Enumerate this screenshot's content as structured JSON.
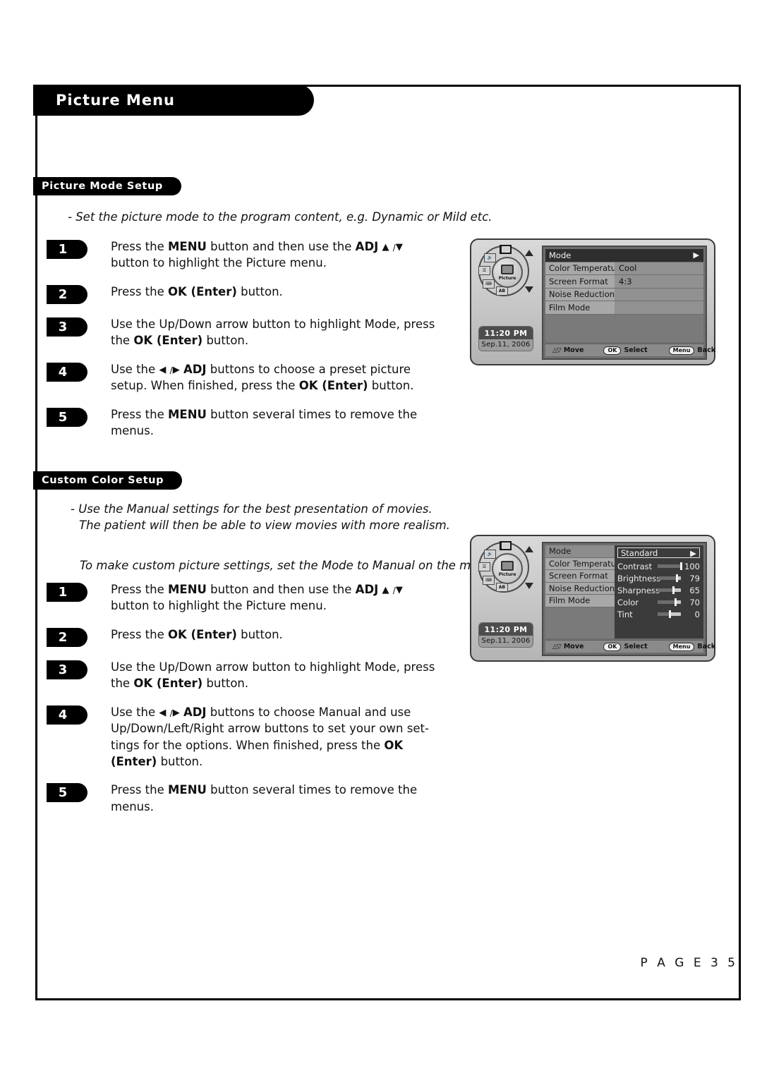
{
  "header": {
    "title": "Picture Menu"
  },
  "sections": [
    {
      "badge": "Picture Mode Setup",
      "intro": "- Set the picture mode to the program content, e.g. Dynamic or Mild etc.",
      "steps": [
        {
          "num": "1",
          "html": "Press the <b>MENU</b> button and then use the <b>ADJ</b> <span class=\"arrowglyph\">▲</span> <span class=\"sep\">/</span><span class=\"arrowglyph\">▼</span> button to highlight the Picture menu."
        },
        {
          "num": "2",
          "html": "Press the <b>OK (Enter)</b> button."
        },
        {
          "num": "3",
          "html": "Use the Up/Down arrow button to highlight Mode, press the <b>OK (Enter)</b> button."
        },
        {
          "num": "4",
          "html": "Use the <span class=\"arrowglyph\">◀</span> <span class=\"sep\">/</span><span class=\"arrowglyph\">▶</span> <b>ADJ</b> buttons to choose a preset picture setup. When finished, press the <b>OK (Enter)</b> button."
        },
        {
          "num": "5",
          "html": "Press the <b>MENU</b> button several times to remove the menus."
        }
      ]
    },
    {
      "badge": "Custom Color Setup",
      "intro_line_1": "- Use the Manual settings for the best presentation of movies.",
      "intro_line_2": "The patient will then be able to view movies with more realism.",
      "intro_line_3": "To make custom picture settings, set the Mode to Manual on the menu.",
      "steps": [
        {
          "num": "1",
          "html": "Press the <b>MENU</b> button and then use the <b>ADJ</b> <span class=\"arrowglyph\">▲</span> <span class=\"sep\">/</span><span class=\"arrowglyph\">▼</span> button to highlight the Picture menu."
        },
        {
          "num": "2",
          "html": "Press the <b>OK (Enter)</b> button."
        },
        {
          "num": "3",
          "html": "Use the Up/Down arrow button to highlight Mode, press the <b>OK (Enter)</b> button."
        },
        {
          "num": "4",
          "html": "Use the <span class=\"arrowglyph\">◀</span> <span class=\"sep\">/</span><span class=\"arrowglyph\">▶</span> <b>ADJ</b> buttons to choose Manual and use Up/Down/Left/Right arrow buttons to set your own set-tings for the options. When finished, press the <b>OK (Enter)</b> button."
        },
        {
          "num": "5",
          "html": "Press the <b>MENU</b> button several times to remove the menus."
        }
      ]
    }
  ],
  "tv_screen_1": {
    "wheel": {
      "hub_label": "Picture",
      "segments": [
        "screen-icon",
        "volume-icon",
        "antenna-icon",
        "caption-icon",
        "AB"
      ],
      "ab_label": "AB",
      "arrow_up": "▲",
      "arrow_down": "▼"
    },
    "clock": {
      "time": "11:20 PM",
      "date": "Sep.11, 2006"
    },
    "menu_rows": [
      {
        "label": "Mode",
        "value": "",
        "selected": true,
        "caret": "▶"
      },
      {
        "label": "Color Temperature",
        "value": "Cool",
        "selected": false
      },
      {
        "label": "Screen Format",
        "value": "4:3",
        "selected": false
      },
      {
        "label": "Noise Reduction",
        "value": "",
        "selected": false
      },
      {
        "label": "Film Mode",
        "value": "",
        "selected": false
      }
    ],
    "footer": {
      "move_arrows": "△▽",
      "move_label": "Move",
      "ok_button": "OK",
      "select_label": "Select",
      "menu_button": "Menu",
      "back_label": "Back"
    }
  },
  "tv_screen_2": {
    "wheel": {
      "hub_label": "Picture",
      "ab_label": "AB",
      "arrow_up": "▲",
      "arrow_down": "▼"
    },
    "clock": {
      "time": "11:20 PM",
      "date": "Sep.11, 2006"
    },
    "left_rows": [
      {
        "label": "Mode",
        "selected": true
      },
      {
        "label": "Color Temperature",
        "selected": false
      },
      {
        "label": "Screen Format",
        "selected": false
      },
      {
        "label": "Noise Reduction",
        "selected": false
      },
      {
        "label": "Film Mode",
        "selected": false
      }
    ],
    "mode_value": "Standard",
    "mode_caret": "▶",
    "sliders": [
      {
        "name": "Contrast",
        "value": "100",
        "percent": 100
      },
      {
        "name": "Brightness",
        "value": "79",
        "percent": 82
      },
      {
        "name": "Sharpness",
        "value": "65",
        "percent": 68
      },
      {
        "name": "Color",
        "value": "70",
        "percent": 75
      },
      {
        "name": "Tint",
        "value": "0",
        "percent": 50
      }
    ],
    "footer": {
      "move_arrows": "△▽",
      "move_label": "Move",
      "ok_button": "OK",
      "select_label": "Select",
      "menu_button": "Menu",
      "back_label": "Back"
    }
  },
  "footer": {
    "page_number": "P A G E   3 5"
  }
}
